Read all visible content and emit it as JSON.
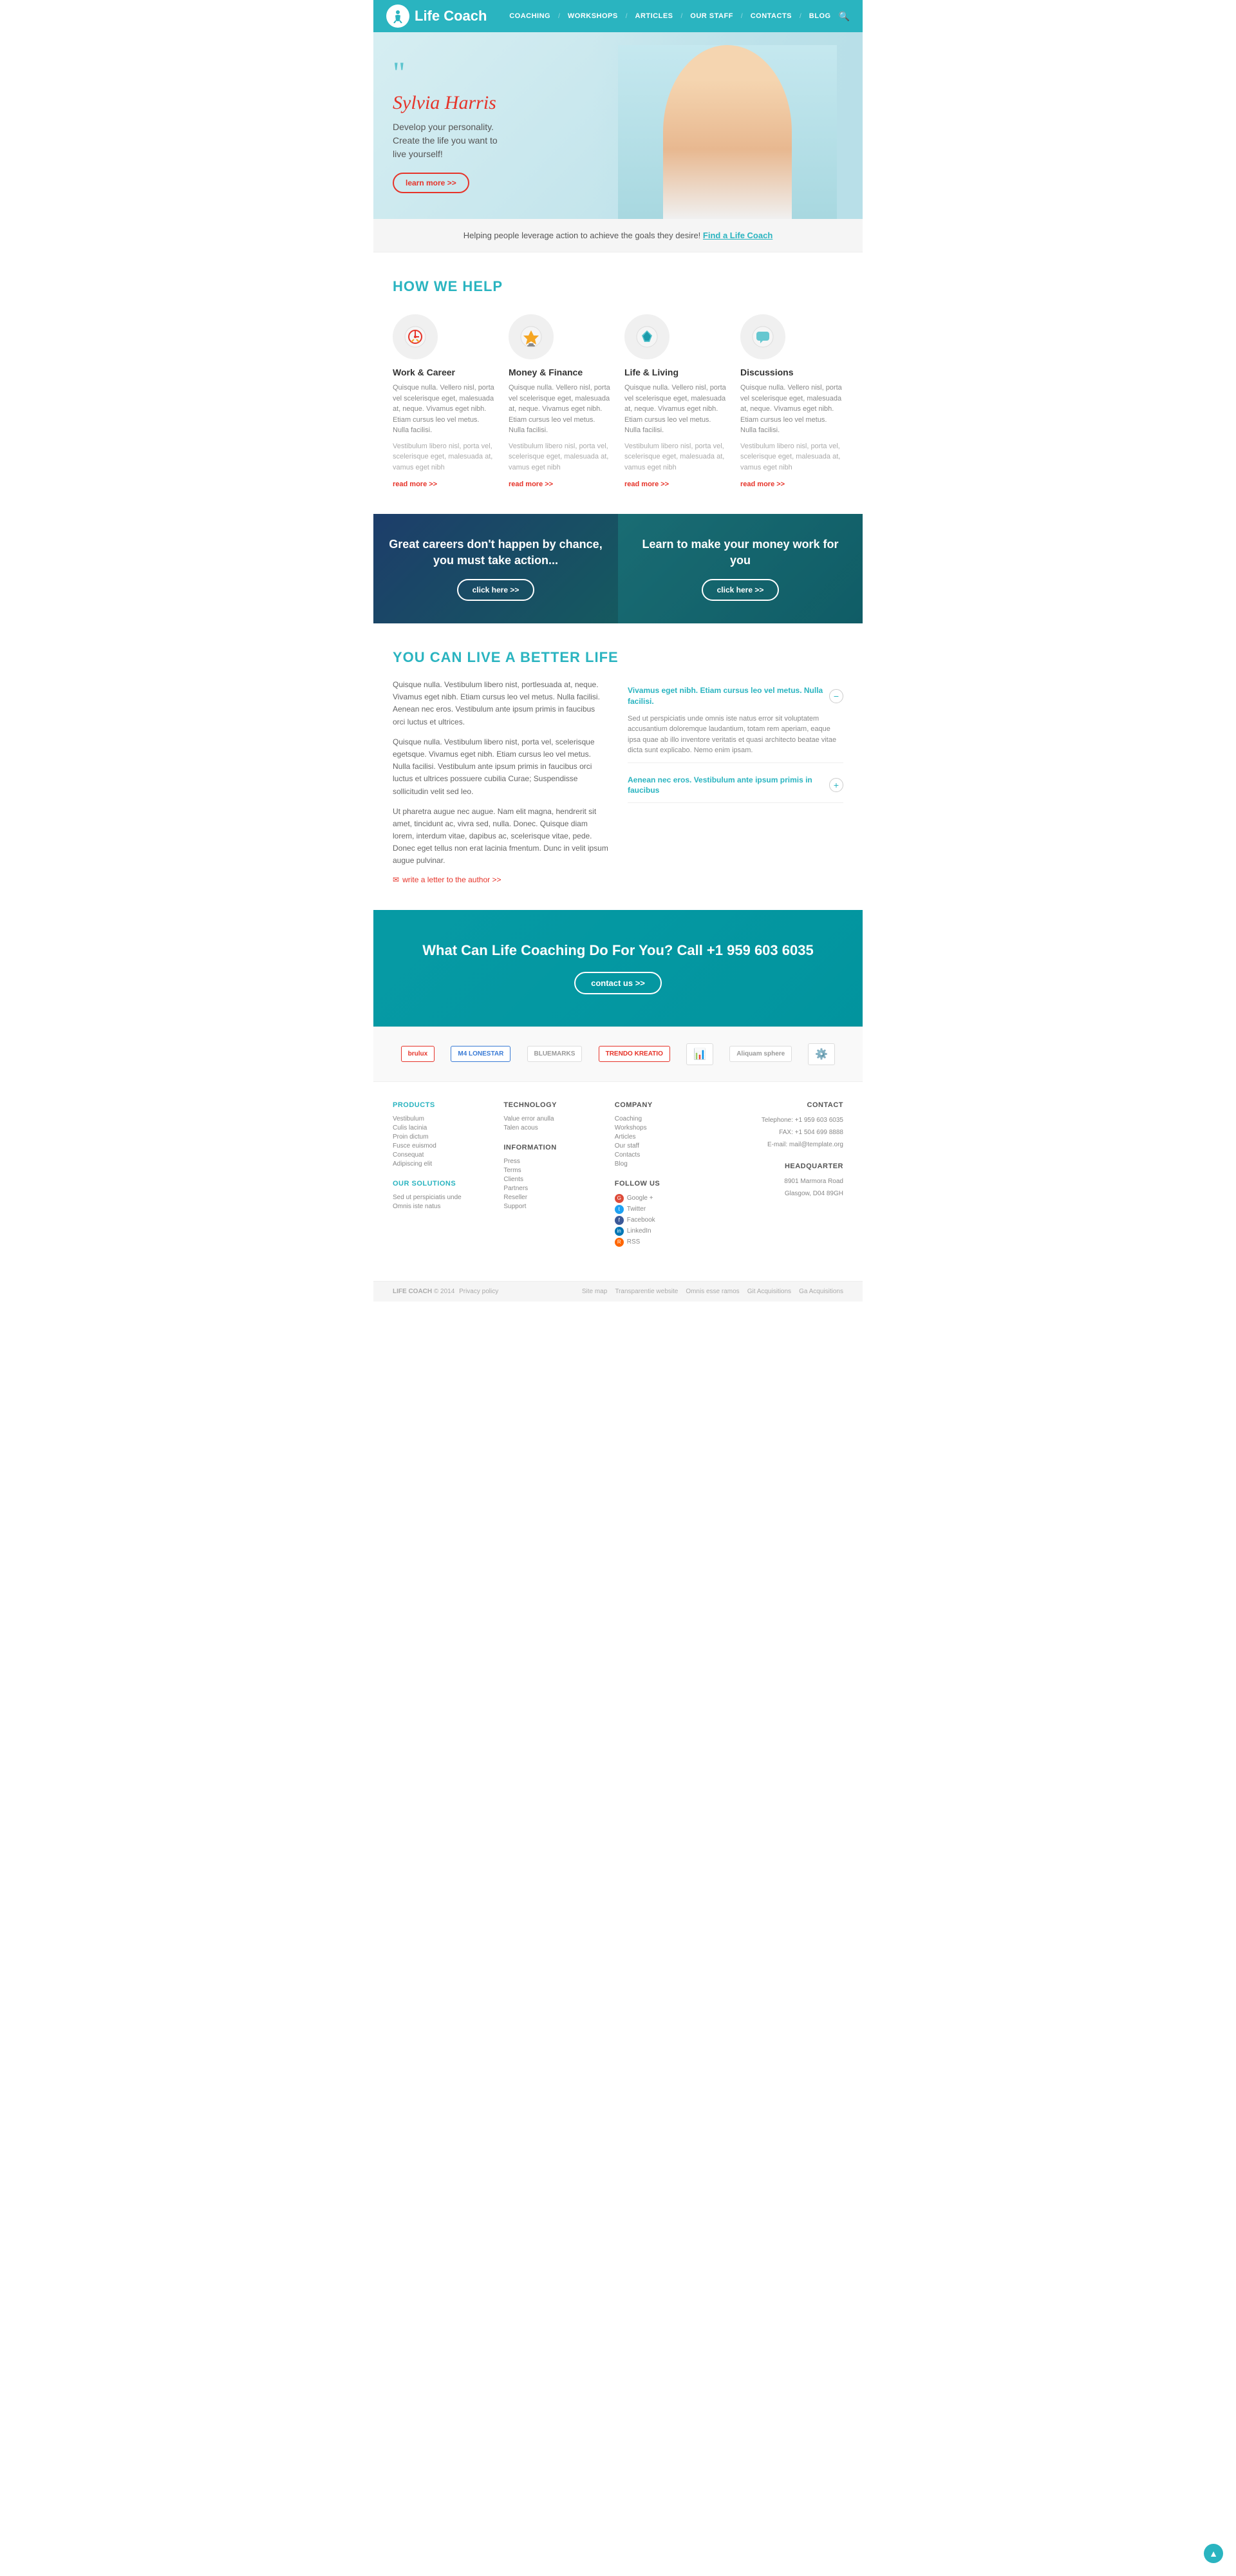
{
  "header": {
    "logo_text": "Life Coach",
    "logo_icon": "🏃",
    "nav_items": [
      {
        "label": "COACHING",
        "sep": true
      },
      {
        "label": "WORKSHOPS",
        "sep": true
      },
      {
        "label": "ARTICLES",
        "sep": true
      },
      {
        "label": "OUR STAFF",
        "sep": true
      },
      {
        "label": "CONTACTS",
        "sep": true
      },
      {
        "label": "BLOG",
        "sep": false
      }
    ]
  },
  "hero": {
    "quotes": "❝❝",
    "name": "Sylvia Harris",
    "tagline_line1": "Develop your personality.",
    "tagline_line2": "Create the life you want to",
    "tagline_line3": "live yourself!",
    "cta_label": "learn more >>"
  },
  "tagline_bar": {
    "text": "Helping people leverage action to achieve the goals they desire!",
    "link_text": "Find a Life Coach"
  },
  "how_we_help": {
    "title": "HOW WE HELP",
    "items": [
      {
        "icon": "🎯",
        "title": "Work & Career",
        "text": "Quisque nulla. Vellero nisl, porta vel scelerisque eget, malesuada at, neque. Vivamus eget nibh. Etiam cursus leo vel metus. Nulla facilisi.",
        "text2": "Vestibulum libero nisl, porta vel, scelerisque eget, malesuada at, vamus eget nibh",
        "read_more": "read more >>"
      },
      {
        "icon": "🏆",
        "title": "Money & Finance",
        "text": "Quisque nulla. Vellero nisl, porta vel scelerisque eget, malesuada at, neque. Vivamus eget nibh. Etiam cursus leo vel metus. Nulla facilisi.",
        "text2": "Vestibulum libero nisl, porta vel, scelerisque eget, malesuada at, vamus eget nibh",
        "read_more": "read more >>"
      },
      {
        "icon": "💎",
        "title": "Life & Living",
        "text": "Quisque nulla. Vellero nisl, porta vel scelerisque eget, malesuada at, neque. Vivamus eget nibh. Etiam cursus leo vel metus. Nulla facilisi.",
        "text2": "Vestibulum libero nisl, porta vel, scelerisque eget, malesuada at, vamus eget nibh",
        "read_more": "read more >>"
      },
      {
        "icon": "💬",
        "title": "Discussions",
        "text": "Quisque nulla. Vellero nisl, porta vel scelerisque eget, malesuada at, neque. Vivamus eget nibh. Etiam cursus leo vel metus. Nulla facilisi.",
        "text2": "Vestibulum libero nisl, porta vel, scelerisque eget, malesuada at, vamus eget nibh",
        "read_more": "read more >>"
      }
    ]
  },
  "cta_split": {
    "left": {
      "title": "Great careers don't happen by chance, you must take action...",
      "cta": "click here >>"
    },
    "right": {
      "title": "Learn to make your money work for you",
      "cta": "click here >>"
    }
  },
  "better_life": {
    "title": "YOU CAN LIVE A BETTER LIFE",
    "para1": "Quisque nulla. Vestibulum libero nist, portlesuada at, neque. Vivamus eget nibh. Etiam cursus leo vel metus. Nulla facilisi. Aenean nec eros. Vestibulum ante ipsum primis in faucibus orci luctus et ultrices.",
    "para2": "Quisque nulla. Vestibulum libero nist, porta vel, scelerisque egetsque. Vivamus eget nibh. Etiam cursus leo vel metus. Nulla facilisi. Vestibulum ante ipsum primis in faucibus orci luctus et ultrices possuere cubilia Curae; Suspendisse sollicitudin velit sed leo.",
    "para3": "Ut pharetra augue nec augue. Nam elit magna, hendrerit sit amet, tincidunt ac, vivra sed, nulla. Donec. Quisque diam lorem, interdum vitae, dapibus ac, scelerisque vitae, pede. Donec eget tellus non erat lacinia fmentum. Dunc in velit ipsum augue pulvinar.",
    "write_letter": "write a letter to the author >>",
    "accordion": [
      {
        "title": "Vivamus eget nibh. Etiam cursus leo vel metus. Nulla facilisi.",
        "content": "Sed ut perspiciatis unde omnis iste natus error sit voluptatem accusantium doloremque laudantium, totam rem aperiam, eaque ipsa quae ab illo inventore veritatis et quasi architecto beatae vitae dicta sunt explicabo. Nemo enim ipsam.",
        "open": true
      },
      {
        "title": "Aenean nec eros. Vestibulum ante ipsum primis in faucibus",
        "content": "",
        "open": false
      }
    ]
  },
  "call_cta": {
    "title": "What Can Life Coaching Do For You? Call +1 959 603 6035",
    "cta": "contact us >>"
  },
  "partners": [
    {
      "label": "brulux",
      "style": "red"
    },
    {
      "label": "M4 LONESTAR",
      "style": "blue"
    },
    {
      "label": "BLUEMARKS",
      "style": ""
    },
    {
      "label": "TRENDO KREATIO",
      "style": "red"
    },
    {
      "label": "📊",
      "style": ""
    },
    {
      "label": "Aliquam sphere",
      "style": ""
    },
    {
      "label": "⚙",
      "style": ""
    }
  ],
  "footer": {
    "products": {
      "title": "PRODUCTS",
      "links": [
        "Vestibulum",
        "Culis lacinia",
        "Proin dictum",
        "Fusce euismod",
        "Consequat",
        "Adipiscing elit"
      ]
    },
    "our_solutions": {
      "title": "OUR SOLUTIONS",
      "links": [
        "Sed ut perspiciatis unde",
        "Omnis iste natus"
      ]
    },
    "technology": {
      "title": "TECHNOLOGY",
      "links": [
        "Value error anulla",
        "Talen acous"
      ]
    },
    "information": {
      "title": "INFORMATION",
      "links": [
        "Press",
        "Terms",
        "Clients",
        "Partners",
        "Reseller",
        "Support"
      ]
    },
    "company": {
      "title": "COMPANY",
      "links": [
        "Coaching",
        "Workshops",
        "Articles",
        "Our staff",
        "Contacts",
        "Blog"
      ]
    },
    "follow_us": {
      "title": "FOLLOW US",
      "links": [
        "Google +",
        "Twitter",
        "Facebook",
        "LinkedIn",
        "RSS"
      ]
    },
    "contact": {
      "title": "CONTACT",
      "telephone": "+1 959 603 6035",
      "fax": "+1 504 699 8888",
      "email": "mail@template.org"
    },
    "headquarter": {
      "title": "HEADQUARTER",
      "address": "8901 Marmora Road",
      "city": "Glasgow, D04 89GH"
    }
  },
  "footer_bottom": {
    "brand": "LIFE COACH",
    "year": "© 2014",
    "privacy": "Privacy policy",
    "links": [
      "Site map",
      "Transparentie website",
      "Omnis esse ramos",
      "Git Acquisitions",
      "Ga Acquisitions"
    ]
  }
}
